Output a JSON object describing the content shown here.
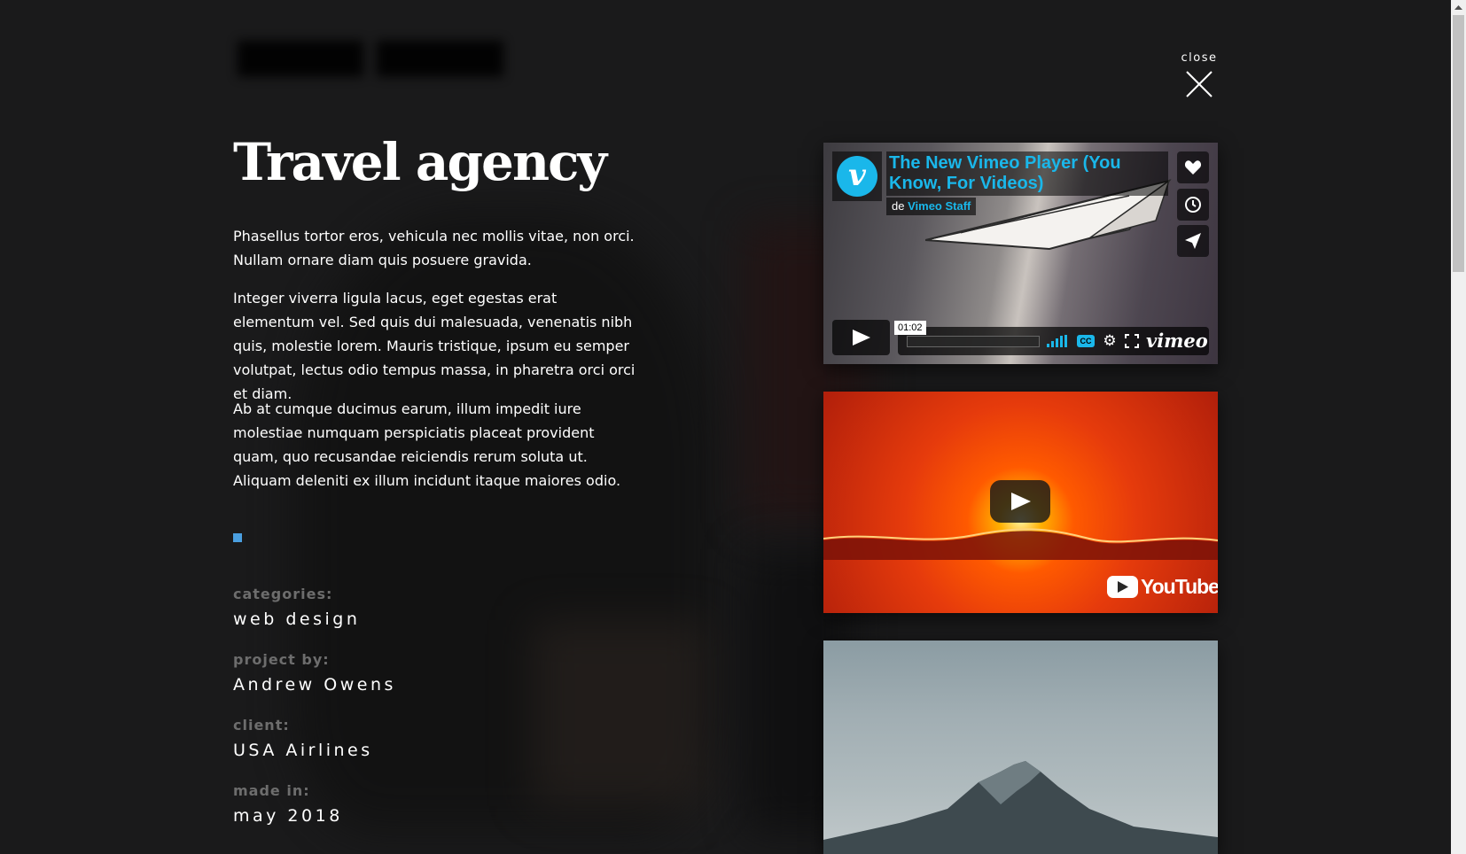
{
  "header": {
    "close_label": "close"
  },
  "project": {
    "title": "Travel agency",
    "paragraphs": [
      "Phasellus tortor eros, vehicula nec mollis vitae, non orci. Nullam ornare diam quis posuere gravida.",
      "Integer viverra ligula lacus, eget egestas erat elementum vel. Sed quis dui malesuada, venenatis nibh quis, molestie lorem. Mauris tristique, ipsum eu semper volutpat, lectus odio tempus massa, in pharetra orci orci et diam.",
      "Ab at cumque ducimus earum, illum impedit iure molestiae numquam perspiciatis placeat provident quam, quo recusandae reiciendis rerum soluta ut. Aliquam deleniti ex illum incidunt itaque maiores odio."
    ],
    "meta": {
      "categories_label": "categories:",
      "categories_value": "web design",
      "project_by_label": "project by:",
      "project_by_value": "Andrew Owens",
      "client_label": "client:",
      "client_value": "USA Airlines",
      "made_in_label": "made in:",
      "made_in_value": "may 2018"
    },
    "accent_color": "#4a9fe0"
  },
  "media": {
    "vimeo": {
      "title": "The New Vimeo Player (You Know, For Videos)",
      "by_prefix": "de",
      "author": "Vimeo Staff",
      "time": "01:02",
      "cc_label": "CC",
      "brand": "vimeo",
      "accent_color": "#1ab7ea"
    },
    "youtube": {
      "brand": "YouTube"
    }
  }
}
